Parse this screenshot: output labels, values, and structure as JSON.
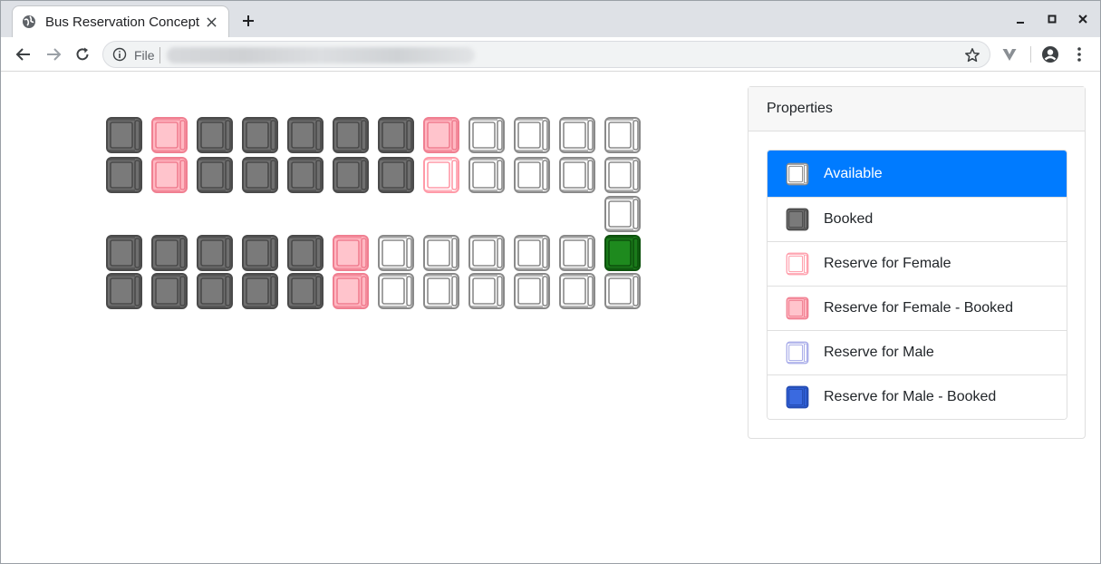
{
  "browser": {
    "tab_title": "Bus Reservation Concept",
    "scheme_label": "File"
  },
  "colors": {
    "available": "#8a8a8a",
    "booked": "#6f6f6f",
    "female": "#ff9aa8",
    "female_booked_fill": "#ffb8c2",
    "male": "#a5a9e8",
    "male_booked": "#2f5fd6",
    "selected": "#1a7a1a",
    "active_item": "#007bff"
  },
  "properties": {
    "title": "Properties",
    "items": [
      {
        "label": "Available",
        "status": "available",
        "active": true
      },
      {
        "label": "Booked",
        "status": "booked",
        "active": false
      },
      {
        "label": "Reserve for Female",
        "status": "female",
        "active": false
      },
      {
        "label": "Reserve for Female - Booked",
        "status": "female_booked",
        "active": false
      },
      {
        "label": "Reserve for Male",
        "status": "male",
        "active": false
      },
      {
        "label": "Reserve for Male - Booked",
        "status": "male_booked",
        "active": false
      }
    ]
  },
  "seat_map": {
    "rows": [
      [
        "booked",
        "female_booked",
        "booked",
        "booked",
        "booked",
        "booked",
        "booked",
        "female_booked",
        "available",
        "available",
        "available",
        "available"
      ],
      [
        "booked",
        "female_booked",
        "booked",
        "booked",
        "booked",
        "booked",
        "booked",
        "female",
        "available",
        "available",
        "available",
        "available"
      ],
      [
        null,
        null,
        null,
        null,
        null,
        null,
        null,
        null,
        null,
        null,
        null,
        "available"
      ],
      [
        "booked",
        "booked",
        "booked",
        "booked",
        "booked",
        "female_booked",
        "available",
        "available",
        "available",
        "available",
        "available",
        "selected"
      ],
      [
        "booked",
        "booked",
        "booked",
        "booked",
        "booked",
        "female_booked",
        "available",
        "available",
        "available",
        "available",
        "available",
        "available"
      ]
    ]
  }
}
